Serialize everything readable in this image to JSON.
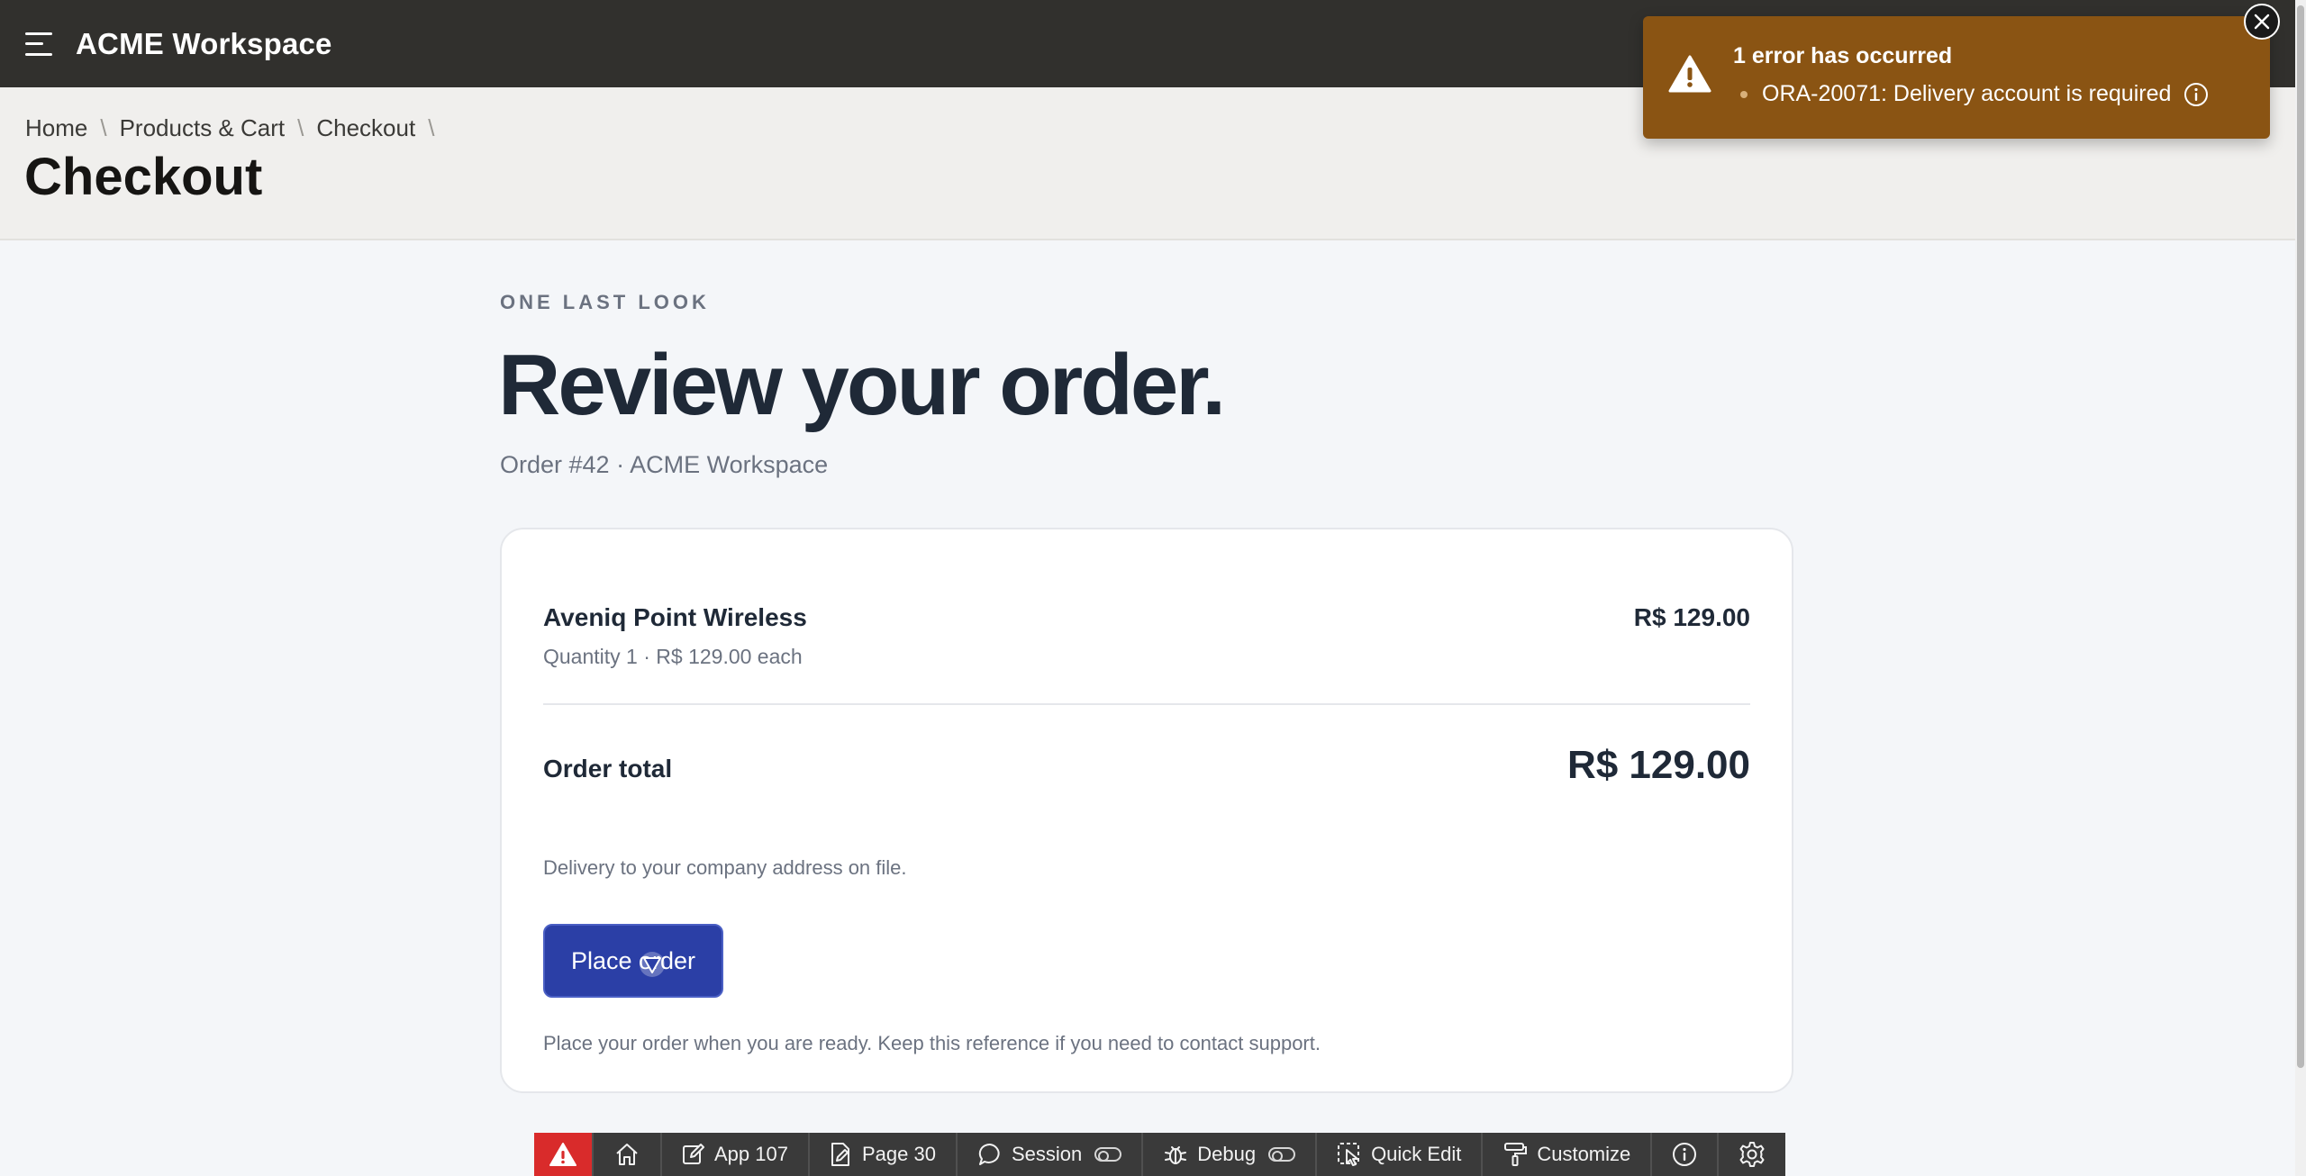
{
  "app": {
    "title": "ACME Workspace"
  },
  "breadcrumb": {
    "items": [
      "Home",
      "Products & Cart",
      "Checkout"
    ],
    "separator": "\\"
  },
  "page": {
    "title": "Checkout"
  },
  "review": {
    "eyebrow": "ONE LAST LOOK",
    "headline": "Review your order.",
    "subline": "Order #42 · ACME Workspace"
  },
  "order": {
    "item_name": "Aveniq Point Wireless",
    "item_price": "R$ 129.00",
    "item_meta": "Quantity 1 · R$ 129.00 each",
    "total_label": "Order total",
    "total_value": "R$ 129.00",
    "delivery_note": "Delivery to your company address on file.",
    "place_button": "Place order",
    "help_note": "Place your order when you are ready. Keep this reference if you need to contact support."
  },
  "toast": {
    "title": "1 error has occurred",
    "message": "ORA-20071: Delivery account is required",
    "color": "#8a5413"
  },
  "devbar": {
    "app": "App 107",
    "page": "Page 30",
    "session": "Session",
    "debug": "Debug",
    "quick_edit": "Quick Edit",
    "customize": "Customize"
  },
  "colors": {
    "primary_button": "#2b3fa6",
    "topbar": "#31302d",
    "error": "#d92b2b"
  }
}
